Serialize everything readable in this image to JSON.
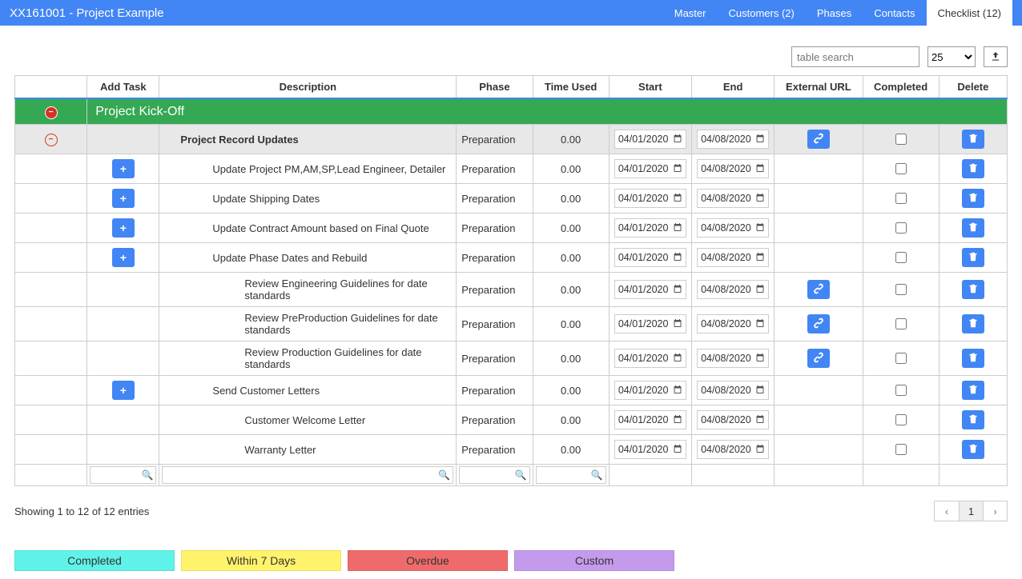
{
  "header": {
    "title": "XX161001 - Project Example",
    "tabs": [
      {
        "label": "Master"
      },
      {
        "label": "Customers (2)"
      },
      {
        "label": "Phases"
      },
      {
        "label": "Contacts"
      },
      {
        "label": "Checklist (12)",
        "active": true
      }
    ]
  },
  "toolbar": {
    "search_placeholder": "table search",
    "page_size": "25"
  },
  "columns": {
    "collapse": "",
    "addtask": "Add Task",
    "description": "Description",
    "phase": "Phase",
    "time": "Time Used",
    "start": "Start",
    "end": "End",
    "url": "External URL",
    "completed": "Completed",
    "delete": "Delete"
  },
  "group": {
    "title": "Project Kick-Off"
  },
  "rows": [
    {
      "type": "sub",
      "collapse": true,
      "desc": "Project Record Updates",
      "indent": 1,
      "phase": "Preparation",
      "time": "0.00",
      "start": "04/01/2020",
      "end": "04/08/2020",
      "url": true,
      "del": true,
      "add": false
    },
    {
      "type": "data",
      "desc": "Update Project PM,AM,SP,Lead Engineer, Detailer",
      "indent": 2,
      "phase": "Preparation",
      "time": "0.00",
      "start": "04/01/2020",
      "end": "04/08/2020",
      "url": false,
      "del": true,
      "add": true
    },
    {
      "type": "data",
      "desc": "Update Shipping Dates",
      "indent": 2,
      "phase": "Preparation",
      "time": "0.00",
      "start": "04/01/2020",
      "end": "04/08/2020",
      "url": false,
      "del": true,
      "add": true
    },
    {
      "type": "data",
      "desc": "Update Contract Amount based on Final Quote",
      "indent": 2,
      "phase": "Preparation",
      "time": "0.00",
      "start": "04/01/2020",
      "end": "04/08/2020",
      "url": false,
      "del": true,
      "add": true
    },
    {
      "type": "data",
      "desc": "Update Phase Dates and Rebuild",
      "indent": 2,
      "phase": "Preparation",
      "time": "0.00",
      "start": "04/01/2020",
      "end": "04/08/2020",
      "url": false,
      "del": true,
      "add": true
    },
    {
      "type": "data",
      "desc": "Review Engineering Guidelines for date standards",
      "indent": 3,
      "phase": "Preparation",
      "time": "0.00",
      "start": "04/01/2020",
      "end": "04/08/2020",
      "url": true,
      "del": true,
      "add": false
    },
    {
      "type": "data",
      "desc": "Review PreProduction Guidelines for date standards",
      "indent": 3,
      "phase": "Preparation",
      "time": "0.00",
      "start": "04/01/2020",
      "end": "04/08/2020",
      "url": true,
      "del": true,
      "add": false
    },
    {
      "type": "data",
      "desc": "Review Production Guidelines for date standards",
      "indent": 3,
      "phase": "Preparation",
      "time": "0.00",
      "start": "04/01/2020",
      "end": "04/08/2020",
      "url": true,
      "del": true,
      "add": false
    },
    {
      "type": "data",
      "desc": "Send Customer Letters",
      "indent": 2,
      "phase": "Preparation",
      "time": "0.00",
      "start": "04/01/2020",
      "end": "04/08/2020",
      "url": false,
      "del": true,
      "add": true
    },
    {
      "type": "data",
      "desc": "Customer Welcome Letter",
      "indent": 3,
      "phase": "Preparation",
      "time": "0.00",
      "start": "04/01/2020",
      "end": "04/08/2020",
      "url": false,
      "del": true,
      "add": false
    },
    {
      "type": "data",
      "desc": "Warranty Letter",
      "indent": 3,
      "phase": "Preparation",
      "time": "0.00",
      "start": "04/01/2020",
      "end": "04/08/2020",
      "url": false,
      "del": true,
      "add": false
    }
  ],
  "footer": {
    "info": "Showing 1 to 12 of 12 entries",
    "page": "1"
  },
  "legend": {
    "completed": "Completed",
    "within": "Within 7 Days",
    "overdue": "Overdue",
    "custom": "Custom"
  }
}
